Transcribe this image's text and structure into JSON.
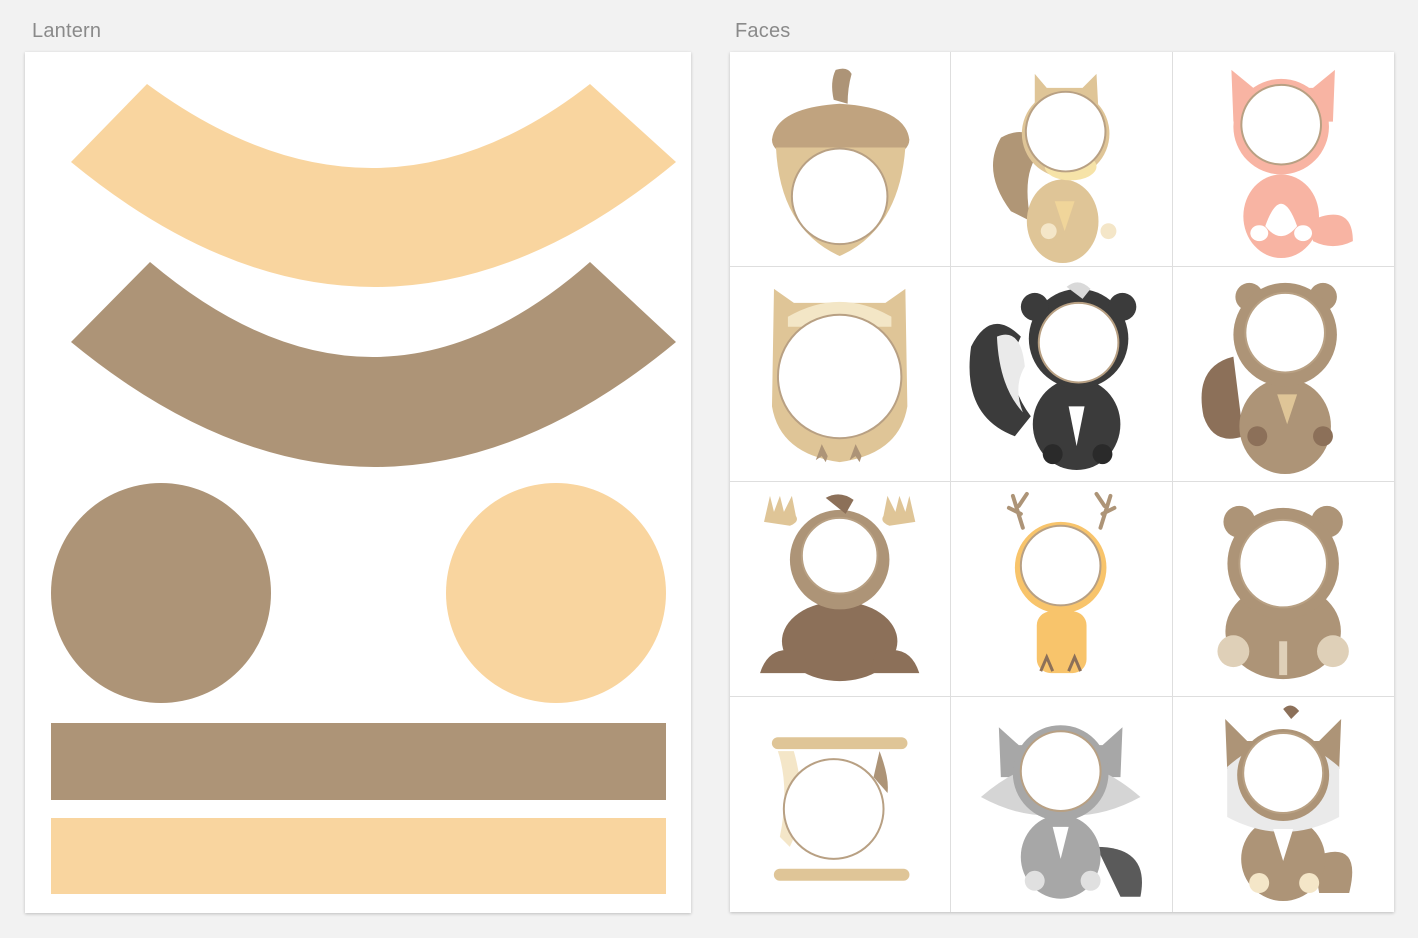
{
  "artboards": {
    "lantern": {
      "title": "Lantern"
    },
    "faces": {
      "title": "Faces"
    }
  },
  "colors": {
    "peach": "#f9d59f",
    "tan": "#ad9477",
    "brown": "#8c7059",
    "light_tan": "#dfc597",
    "pink": "#f8b4a3",
    "dark": "#3b3b3b",
    "gray": "#a7a7a7",
    "yellow": "#f8c46b",
    "face_ring": "#b8a083"
  },
  "faces": [
    {
      "icon": "acorn-icon"
    },
    {
      "icon": "squirrel-icon"
    },
    {
      "icon": "fox-icon"
    },
    {
      "icon": "owl-icon"
    },
    {
      "icon": "skunk-icon"
    },
    {
      "icon": "beaver-icon"
    },
    {
      "icon": "moose-icon"
    },
    {
      "icon": "deer-icon"
    },
    {
      "icon": "bear-icon"
    },
    {
      "icon": "scroll-icon"
    },
    {
      "icon": "raccoon-icon"
    },
    {
      "icon": "wolf-icon"
    }
  ]
}
